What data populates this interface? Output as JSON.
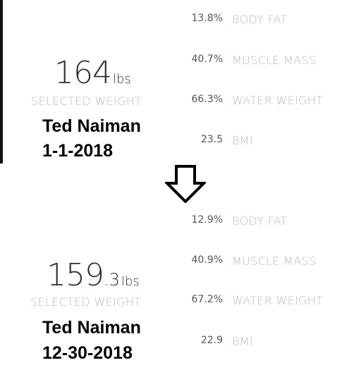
{
  "before": {
    "weight_main": "164",
    "weight_frac": "",
    "weight_unit": "lbs",
    "selected_label": "SELECTED WEIGHT",
    "name": "Ted Naiman",
    "date": "1-1-2018",
    "metrics": [
      {
        "value": "13.8%",
        "label": "BODY FAT"
      },
      {
        "value": "40.7%",
        "label": "MUSCLE MASS"
      },
      {
        "value": "66.3%",
        "label": "WATER WEIGHT"
      },
      {
        "value": "23.5",
        "label": "BMI"
      }
    ]
  },
  "arrow": {
    "icon": "down-arrow-icon"
  },
  "after": {
    "weight_main": "159",
    "weight_frac": ".3",
    "weight_unit": "lbs",
    "selected_label": "SELECTED WEIGHT",
    "name": "Ted Naiman",
    "date": "12-30-2018",
    "metrics": [
      {
        "value": "12.9%",
        "label": "BODY FAT"
      },
      {
        "value": "40.9%",
        "label": "MUSCLE MASS"
      },
      {
        "value": "67.2%",
        "label": "WATER WEIGHT"
      },
      {
        "value": "22.9",
        "label": "BMI"
      }
    ]
  }
}
